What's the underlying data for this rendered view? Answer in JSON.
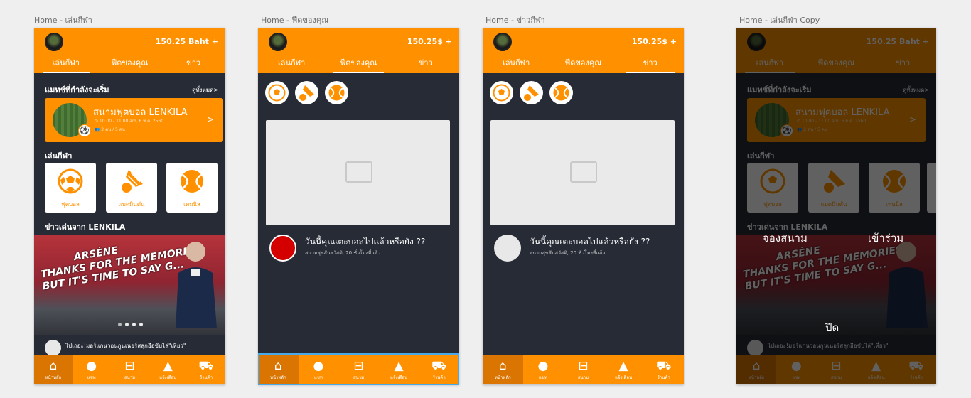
{
  "artboards": [
    {
      "label": "Home - เล่นกีฬา"
    },
    {
      "label": "Home - ฟีดของคุณ"
    },
    {
      "label": "Home - ข่าวกีฬา"
    },
    {
      "label": "Home - เล่นกีฬา Copy"
    }
  ],
  "header": {
    "balance_baht": "150.25 Baht +",
    "balance_usd": "150.25$ +",
    "tabs": [
      "เล่นกีฬา",
      "ฟีดของคุณ",
      "ข่าว"
    ]
  },
  "home": {
    "upcoming_title": "แมทช์ที่กำลังจะเริ่ม",
    "see_all": "ดูทั้งหมด>",
    "match": {
      "title": "สนามฟุตบอล LENKILA",
      "time": "⊙ 10.00 - 11.00 am, 6 พ.ค. 2560",
      "people": "👥 2 คน / 5 คน",
      "arrow": ">"
    },
    "play_title": "เล่นกีฬา",
    "sports": [
      "ฟุตบอล",
      "แบดมินตัน",
      "เทนนิส"
    ],
    "news_title": "ข่าวเด่นจาก LENKILA",
    "banner_line1": "ARSÈNE",
    "banner_line2": "THANKS FOR THE MEMORIES",
    "banner_line3": "BUT IT'S TIME TO SAY G...",
    "news_strip_text": "ไปเถอะ!มอร์แกนวอนกูนเนอร์สลุกฮือขับไล่\"เหี่ยว\""
  },
  "feed": {
    "post_title": "วันนี้คุณเตะบอลไปแล้วหรือยัง ??",
    "post_meta": "สนามสุขสันสวัสดิ, 20 ชั่วโมงที่แล้ว"
  },
  "overlay": {
    "book_field": "จองสนาม",
    "join": "เข้าร่วม",
    "close": "ปิด"
  },
  "bottom_nav": [
    "หน้าหลัก",
    "แชท",
    "สนาม",
    "แจ้งเตือน",
    "ร้านค้า"
  ],
  "colors": {
    "accent": "#ff9100",
    "dark_bg": "#272b36",
    "selection": "#48a8e8",
    "red_avatar": "#d40000"
  },
  "icons": {
    "nav": [
      "home-icon",
      "chat-icon",
      "field-icon",
      "bell-icon",
      "cart-icon"
    ],
    "sports": [
      "soccer-ball-icon",
      "shuttlecock-icon",
      "tennis-ball-icon"
    ]
  }
}
